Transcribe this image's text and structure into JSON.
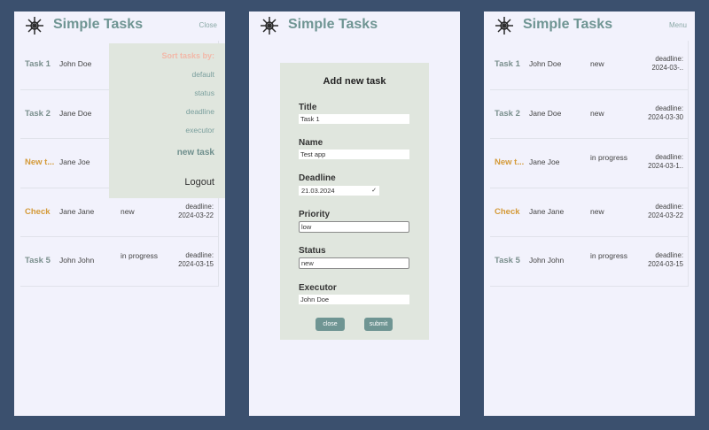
{
  "app": {
    "title": "Simple Tasks"
  },
  "screens": {
    "left": {
      "header_button": "Close"
    },
    "middle": {},
    "right": {
      "header_button": "Menu"
    }
  },
  "tasks": [
    {
      "title": "Task 1",
      "name": "John Doe",
      "status": "new",
      "deadline_label": "deadline:",
      "deadline": "2024-03-..",
      "urgent": false
    },
    {
      "title": "Task 2",
      "name": "Jane Doe",
      "status": "new",
      "deadline_label": "deadline:",
      "deadline": "2024-03-30",
      "urgent": false
    },
    {
      "title": "New t...",
      "name": "Jane Joe",
      "status": "in progress",
      "deadline_label": "deadline:",
      "deadline": "2024-03-1..",
      "urgent": true
    },
    {
      "title": "Check",
      "name": "Jane Jane",
      "status": "new",
      "deadline_label": "deadline:",
      "deadline": "2024-03-22",
      "urgent": true
    },
    {
      "title": "Task 5",
      "name": "John John",
      "status": "in progress",
      "deadline_label": "deadline:",
      "deadline": "2024-03-15",
      "urgent": false
    }
  ],
  "left_tasks": [
    {
      "title": "Task 1",
      "name": "John Doe"
    },
    {
      "title": "Task 2",
      "name": "Jane Doe"
    },
    {
      "title": "New t...",
      "name": "Jane Joe"
    },
    {
      "title": "Check",
      "name": "Jane Jane",
      "status": "new",
      "deadline_label": "deadline:",
      "deadline": "2024-03-22"
    },
    {
      "title": "Task 5",
      "name": "John John",
      "status": "in progress",
      "deadline_label": "deadline:",
      "deadline": "2024-03-15"
    }
  ],
  "sort_menu": {
    "header": "Sort tasks by:",
    "options": [
      "default",
      "status",
      "deadline",
      "executor"
    ],
    "new_task": "new task",
    "logout": "Logout"
  },
  "add_task_form": {
    "heading": "Add new task",
    "title_label": "Title",
    "title_value": "Task 1",
    "name_label": "Name",
    "name_value": "Test app",
    "deadline_label": "Deadline",
    "deadline_value": "21.03.2024",
    "priority_label": "Priority",
    "priority_value": "low",
    "status_label": "Status",
    "status_value": "new",
    "executor_label": "Executor",
    "executor_value": "John Doe",
    "close_button": "close",
    "submit_button": "submit"
  },
  "colors": {
    "background": "#3b506e",
    "panel": "#f2f2fc",
    "accent": "#6f9593",
    "urgent": "#d49a38",
    "overlay": "#e0e6de"
  }
}
